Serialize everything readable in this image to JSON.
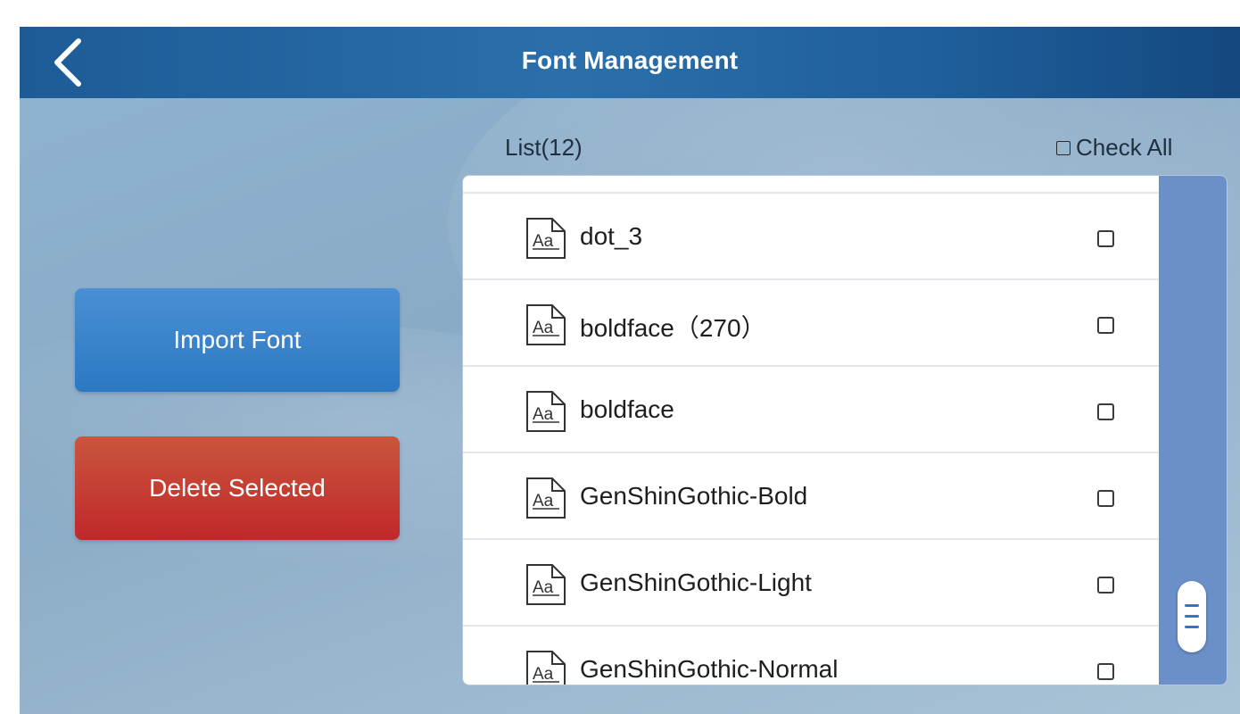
{
  "header": {
    "title": "Font Management",
    "back_icon": "chevron-left-icon"
  },
  "actions": {
    "import_label": "Import Font",
    "delete_label": "Delete Selected"
  },
  "list": {
    "title": "List(12)",
    "check_all_label": "Check All",
    "items": [
      {
        "name": "dot_3",
        "checked": false
      },
      {
        "name": "boldface（270）",
        "checked": false
      },
      {
        "name": "boldface",
        "checked": false
      },
      {
        "name": "GenShinGothic-Bold",
        "checked": false
      },
      {
        "name": "GenShinGothic-Light",
        "checked": false
      },
      {
        "name": "GenShinGothic-Normal",
        "checked": false
      }
    ],
    "item_icon": "font-file-icon",
    "icon_glyph": "Aa"
  },
  "colors": {
    "header": "#1f5f9b",
    "import_button": "#2b79c2",
    "delete_button": "#c0282a",
    "scrollbar": "#6a8fc9"
  }
}
